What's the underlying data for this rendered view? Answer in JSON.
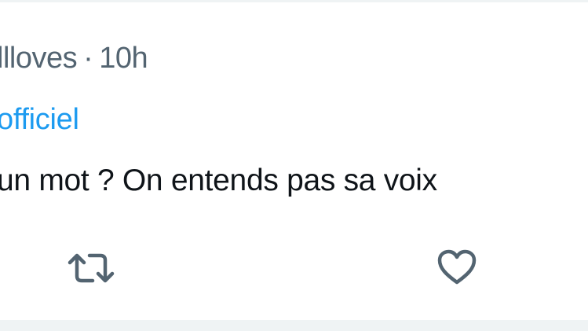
{
  "tweet": {
    "author_handle_fragment": "llloves",
    "separator": "·",
    "timestamp": "10h",
    "reply_to_fragment": "officiel",
    "text": "un mot ? On entends pas sa voix"
  },
  "actions": {
    "retweet_icon": "retweet-icon",
    "like_icon": "heart-icon"
  },
  "colors": {
    "secondary_text": "#536471",
    "link": "#1d9bf0",
    "primary_text": "#0f1419",
    "border": "#eff3f4"
  }
}
